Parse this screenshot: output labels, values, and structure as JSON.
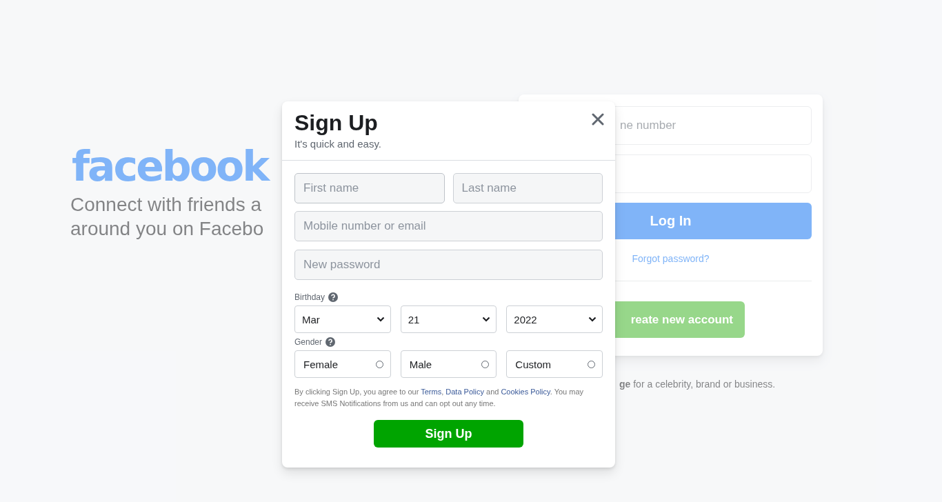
{
  "background": {
    "logo": "facebook",
    "tagline_lines": [
      "Connect with friends a",
      "around you on Facebo"
    ],
    "login": {
      "email_placeholder": "ne number",
      "log_in_button": "Log In",
      "forgot_link": "Forgot password?",
      "create_button": "reate new account"
    },
    "page_note": "**ge** for a celebrity, brand or business."
  },
  "modal": {
    "title": "Sign Up",
    "subtitle": "It's quick and easy.",
    "name_fields": [
      {
        "placeholder": "First name",
        "focused": true
      },
      {
        "placeholder": "Last name",
        "focused": false
      }
    ],
    "fields": [
      {
        "placeholder": "Mobile number or email"
      },
      {
        "placeholder": "New password"
      }
    ],
    "birthday": {
      "label": "Birthday",
      "selects": [
        {
          "value": "Mar"
        },
        {
          "value": "21"
        },
        {
          "value": "2022"
        }
      ]
    },
    "gender": {
      "label": "Gender",
      "options": [
        {
          "label": "Female",
          "selected": false
        },
        {
          "label": "Male",
          "selected": false
        },
        {
          "label": "Custom",
          "selected": false
        }
      ]
    },
    "terms": [
      {
        "text": "By clicking Sign Up, you agree to our ",
        "link": false
      },
      {
        "text": "Terms",
        "link": true
      },
      {
        "text": ", ",
        "link": false
      },
      {
        "text": "Data Policy",
        "link": true
      },
      {
        "text": " and ",
        "link": false
      },
      {
        "text": "Cookies Policy",
        "link": true
      },
      {
        "text": ". You may receive SMS Notifications from us and can opt out any time.",
        "link": false
      }
    ],
    "sign_up_button": "Sign Up"
  }
}
